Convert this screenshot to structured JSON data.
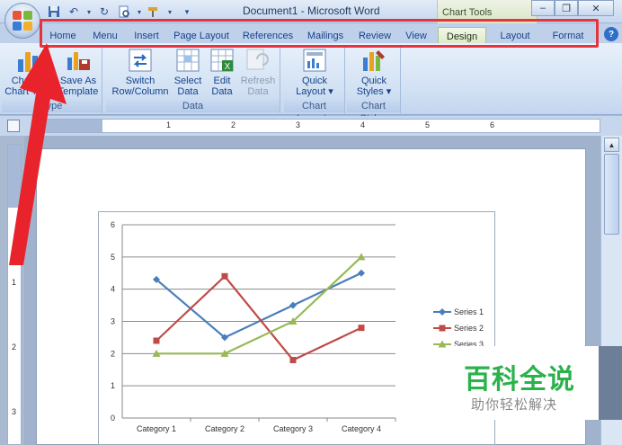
{
  "window": {
    "title": "Document1 - Microsoft Word",
    "context_tab_title": "Chart Tools",
    "controls": [
      "minimize",
      "restore",
      "close"
    ]
  },
  "quick_access": {
    "icons": [
      "save-icon",
      "undo-icon",
      "redo-icon",
      "print-preview-icon",
      "customize-icon"
    ]
  },
  "tabs": [
    {
      "label": "Home",
      "active": false
    },
    {
      "label": "Menu",
      "active": false
    },
    {
      "label": "Insert",
      "active": false
    },
    {
      "label": "Page Layout",
      "active": false
    },
    {
      "label": "References",
      "active": false
    },
    {
      "label": "Mailings",
      "active": false
    },
    {
      "label": "Review",
      "active": false
    },
    {
      "label": "View",
      "active": false
    },
    {
      "label": "Design",
      "active": true
    },
    {
      "label": "Layout",
      "active": false
    },
    {
      "label": "Format",
      "active": false
    }
  ],
  "ribbon": {
    "groups": [
      {
        "label": "Type",
        "buttons": [
          {
            "label_line1": "Change",
            "label_line2": "Chart Type",
            "icon": "change-chart-type-icon"
          },
          {
            "label_line1": "Save As",
            "label_line2": "Template",
            "icon": "save-template-icon"
          }
        ]
      },
      {
        "label": "Data",
        "buttons": [
          {
            "label_line1": "Switch",
            "label_line2": "Row/Column",
            "icon": "switch-row-column-icon"
          },
          {
            "label_line1": "Select",
            "label_line2": "Data",
            "icon": "select-data-icon"
          },
          {
            "label_line1": "Edit",
            "label_line2": "Data",
            "icon": "edit-data-icon"
          },
          {
            "label_line1": "Refresh",
            "label_line2": "Data",
            "icon": "refresh-data-icon",
            "disabled": true
          }
        ]
      },
      {
        "label": "Chart Layouts",
        "buttons": [
          {
            "label_line1": "Quick",
            "label_line2": "Layout ▾",
            "icon": "quick-layout-icon"
          }
        ]
      },
      {
        "label": "Chart Styles",
        "buttons": [
          {
            "label_line1": "Quick",
            "label_line2": "Styles ▾",
            "icon": "quick-styles-icon"
          }
        ]
      }
    ]
  },
  "ruler": {
    "numbers": [
      "1",
      "2",
      "3",
      "4",
      "5",
      "6"
    ]
  },
  "chart_data": {
    "type": "line",
    "categories": [
      "Category 1",
      "Category 2",
      "Category 3",
      "Category 4"
    ],
    "series": [
      {
        "name": "Series 1",
        "values": [
          4.3,
          2.5,
          3.5,
          4.5
        ],
        "color": "#4a7ebb",
        "marker": "diamond"
      },
      {
        "name": "Series 2",
        "values": [
          2.4,
          4.4,
          1.8,
          2.8
        ],
        "color": "#be4b48",
        "marker": "square"
      },
      {
        "name": "Series 3",
        "values": [
          2,
          2,
          3,
          5
        ],
        "color": "#98b954",
        "marker": "triangle"
      }
    ],
    "yticks": [
      "0",
      "1",
      "2",
      "3",
      "4",
      "5",
      "6"
    ],
    "ylim": [
      0,
      6
    ],
    "grid": true,
    "legend": "right"
  },
  "watermark": {
    "title": "百科全说",
    "subtitle": "助你轻松解决"
  },
  "colors": {
    "highlight": "#e8323c",
    "arrow": "#e8232b",
    "active_tab": "#dbe9c6",
    "watermark_green": "#2bb24c"
  }
}
